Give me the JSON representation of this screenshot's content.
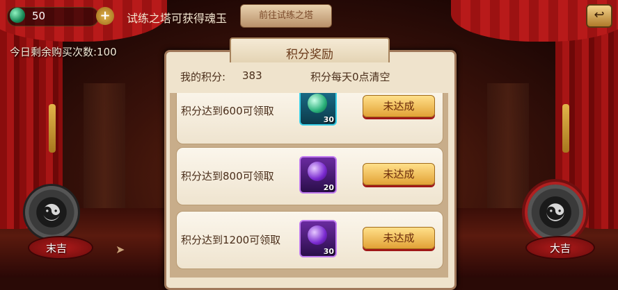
{
  "top_bar": {
    "gem_count": "50",
    "plus_label": "+",
    "trial_text": "试练之塔可获得魂玉",
    "goto_button": "前往试练之塔",
    "back_label": "↩"
  },
  "remaining_purchases": "今日剩余购买次数:100",
  "stage": {
    "left_label": "末吉",
    "right_label": "大吉"
  },
  "panel": {
    "title": "积分奖励",
    "my_score_label": "我的积分:",
    "my_score_value": "383",
    "reset_note": "积分每天0点清空",
    "rewards": [
      {
        "condition": "积分达到600可领取",
        "icon": "teal-orb-icon",
        "qty": "30",
        "status": "未达成"
      },
      {
        "condition": "积分达到800可领取",
        "icon": "purple-orb-icon",
        "qty": "20",
        "status": "未达成"
      },
      {
        "condition": "积分达到1200可领取",
        "icon": "purple-orb-icon",
        "qty": "30",
        "status": "未达成"
      }
    ]
  },
  "colors": {
    "accent": "#e2a236",
    "panel_bg": "#efe3cc",
    "curtain": "#a81515"
  }
}
